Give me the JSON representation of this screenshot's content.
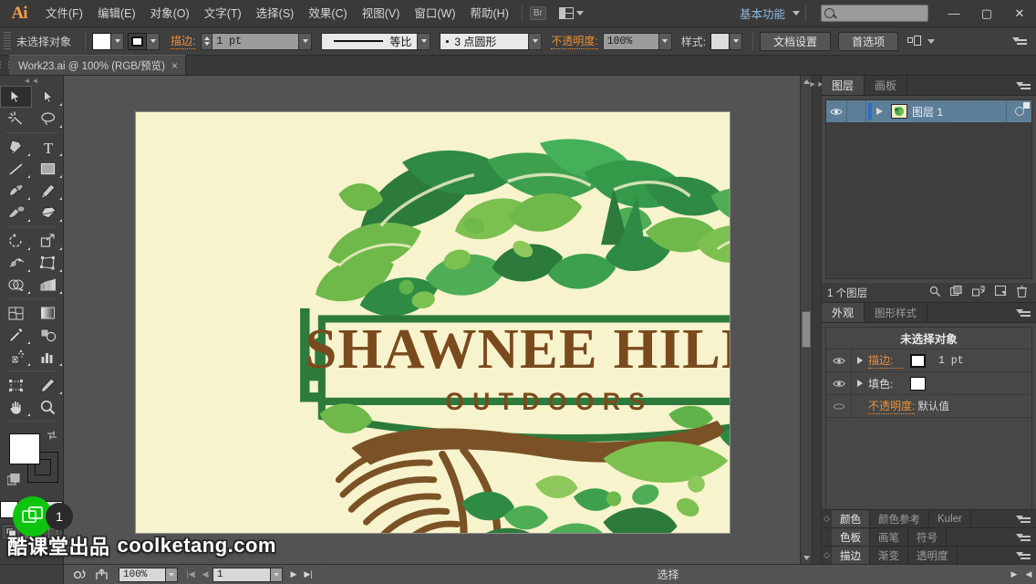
{
  "app": {
    "logo": "Ai",
    "title": "Work23.ai @ 100% (RGB/预览)"
  },
  "menubar": {
    "items": [
      {
        "label": "文件(F)"
      },
      {
        "label": "编辑(E)"
      },
      {
        "label": "对象(O)"
      },
      {
        "label": "文字(T)"
      },
      {
        "label": "选择(S)"
      },
      {
        "label": "效果(C)"
      },
      {
        "label": "视图(V)"
      },
      {
        "label": "窗口(W)"
      },
      {
        "label": "帮助(H)"
      }
    ],
    "bridge_label": "Br",
    "arrange_documents": "arrange-documents-icon",
    "workspace": "基本功能",
    "search_placeholder": "",
    "search_value": "",
    "minimize": "—",
    "maximize": "▢",
    "close": "✕"
  },
  "controlbar": {
    "selection_status": "未选择对象",
    "fill_label": "fill-swatch",
    "stroke_swatch_label": "stroke-swatch",
    "stroke_label": "描边:",
    "stroke_weight": "1 pt",
    "stroke_profile_name": "等比",
    "brush_def": "3 点圆形",
    "opacity_label": "不透明度:",
    "opacity_value": "100%",
    "style_label": "样式:",
    "doc_setup": "文档设置",
    "preferences": "首选项"
  },
  "tabbar": {
    "doc_tab": "Work23.ai @ 100% (RGB/预览)",
    "close": "×"
  },
  "toolbox": {
    "tools": [
      "selection-tool",
      "direct-selection-tool",
      "magic-wand-tool",
      "lasso-tool",
      "pen-tool",
      "type-tool",
      "line-segment-tool",
      "rectangle-tool",
      "paintbrush-tool",
      "pencil-tool",
      "blob-brush-tool",
      "eraser-tool",
      "rotate-tool",
      "scale-tool",
      "width-tool",
      "free-transform-tool",
      "shape-builder-tool",
      "perspective-grid-tool",
      "mesh-tool",
      "gradient-tool",
      "eyedropper-tool",
      "blend-tool",
      "symbol-sprayer-tool",
      "column-graph-tool",
      "artboard-tool",
      "slice-tool",
      "hand-tool",
      "zoom-tool"
    ],
    "selected_tool": "selection-tool",
    "fill_color": "#ffffff",
    "stroke_color": "#000000",
    "draw_modes": [
      "draw-normal",
      "draw-behind",
      "draw-inside"
    ],
    "selected_draw_mode": "draw-behind"
  },
  "canvas": {
    "artboard_bg": "#f7f3cc",
    "logo": {
      "title_line1": "SHAWNEE HILLS",
      "title_line2": "O U T D O O R S",
      "text_color": "#7a4a1e",
      "green_dark": "#1f7a3d",
      "green_mid": "#3aa84f",
      "green_light": "#7fc050",
      "brown": "#7a5225"
    }
  },
  "layers_panel": {
    "tabs": [
      {
        "label": "图层",
        "active": true
      },
      {
        "label": "画板",
        "active": false
      }
    ],
    "rows": [
      {
        "name": "图层 1",
        "visible": true,
        "locked": false,
        "selected": true
      }
    ],
    "footer_count": "1 个图层",
    "footer_icons": [
      "locate-object-icon",
      "make-clipping-mask-icon",
      "create-sublayer-icon",
      "create-new-layer-icon",
      "delete-layer-icon"
    ]
  },
  "appearance_panel": {
    "tabs": [
      {
        "label": "外观",
        "active": true
      },
      {
        "label": "图形样式",
        "active": false
      }
    ],
    "header": "未选择对象",
    "rows": [
      {
        "label": "描边:",
        "orange": true,
        "value": "1 pt",
        "swatch": "#ffffff",
        "has_border": true,
        "has_tri": true
      },
      {
        "label": "填色:",
        "orange": false,
        "value": "",
        "swatch": "#ffffff",
        "has_border": false,
        "has_tri": true
      },
      {
        "label": "不透明度:",
        "orange": true,
        "value": "默认值",
        "swatch": "",
        "has_border": false,
        "has_tri": false
      }
    ],
    "footer_icons": [
      "add-new-stroke-icon",
      "add-new-fill-icon",
      "add-effect-icon",
      "clear-appearance-icon",
      "duplicate-item-icon",
      "delete-item-icon"
    ]
  },
  "bottom_panels": [
    {
      "tabs": [
        {
          "label": "颜色",
          "active": true
        },
        {
          "label": "颜色参考",
          "active": false
        },
        {
          "label": "Kuler",
          "active": false
        }
      ],
      "grip": true
    },
    {
      "tabs": [
        {
          "label": "色板",
          "active": true
        },
        {
          "label": "画笔",
          "active": false
        },
        {
          "label": "符号",
          "active": false
        }
      ],
      "grip": false
    },
    {
      "tabs": [
        {
          "label": "描边",
          "active": true
        },
        {
          "label": "渐变",
          "active": false
        },
        {
          "label": "透明度",
          "active": false
        }
      ],
      "grip": true
    }
  ],
  "statusbar": {
    "zoom_value": "100%",
    "artboard_value": "1",
    "status_text": "选择",
    "icons": [
      "preview-mode-icon",
      "share-icon",
      "first-artboard-icon",
      "prev-artboard-icon",
      "next-artboard-icon",
      "last-artboard-icon"
    ]
  },
  "watermark": {
    "text_cn": "酷课堂出品",
    "text_en": "coolketang.com",
    "badge_number": "1"
  }
}
